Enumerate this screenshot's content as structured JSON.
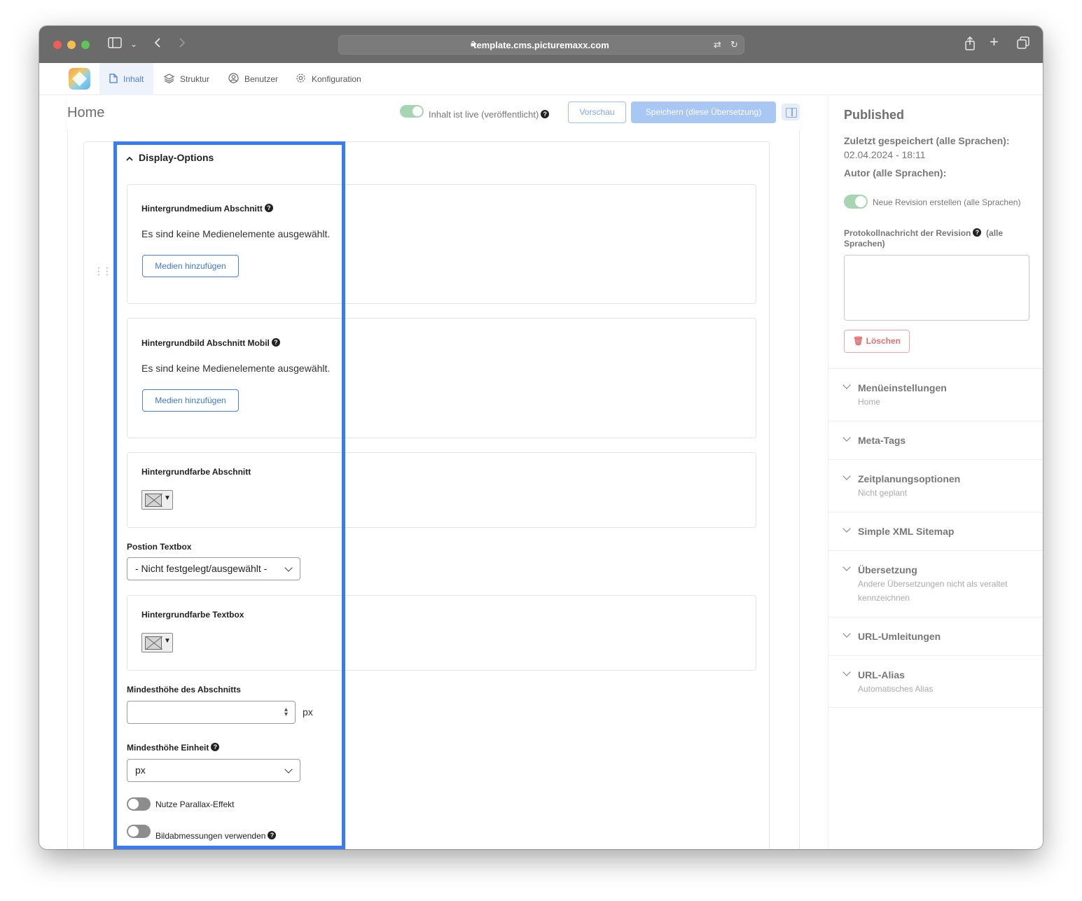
{
  "browser": {
    "url": "template.cms.picturemaxx.com"
  },
  "nav": {
    "items": [
      {
        "label": "Inhalt",
        "icon": "document-icon",
        "active": true
      },
      {
        "label": "Struktur",
        "icon": "layers-icon",
        "active": false
      },
      {
        "label": "Benutzer",
        "icon": "user-icon",
        "active": false
      },
      {
        "label": "Konfiguration",
        "icon": "gear-icon",
        "active": false
      }
    ]
  },
  "header": {
    "title": "Home",
    "live_label": "Inhalt ist live (veröffentlicht)",
    "preview_label": "Vorschau",
    "save_label": "Speichern (diese Übersetzung)"
  },
  "section": {
    "title": "Display-Options",
    "bg_media": {
      "label": "Hintergrundmedium Abschnitt",
      "empty_text": "Es sind keine Medienelemente ausgewählt.",
      "button": "Medien hinzufügen"
    },
    "bg_image_mobile": {
      "label": "Hintergrundbild Abschnitt Mobil",
      "empty_text": "Es sind keine Medienelemente ausgewählt.",
      "button": "Medien hinzufügen"
    },
    "bg_color_section": {
      "label": "Hintergrundfarbe Abschnitt"
    },
    "position_textbox": {
      "label": "Postion Textbox",
      "value": "- Nicht festgelegt/ausgewählt -"
    },
    "bg_color_textbox": {
      "label": "Hintergrundfarbe Textbox"
    },
    "min_height": {
      "label": "Mindesthöhe des Abschnitts",
      "value": "",
      "unit": "px"
    },
    "min_height_unit": {
      "label": "Mindesthöhe Einheit",
      "value": "px"
    },
    "parallax": {
      "label": "Nutze Parallax-Effekt",
      "on": false
    },
    "image_dims": {
      "label": "Bildabmessungen verwenden",
      "on": false
    }
  },
  "sidebar": {
    "status": "Published",
    "last_saved_label": "Zuletzt gespeichert (alle Sprachen):",
    "last_saved_value": "02.04.2024 - 18:11",
    "author_label": "Autor (alle Sprachen):",
    "new_revision_label": "Neue Revision erstellen (alle Sprachen)",
    "revision_log_label": "Protokollnachricht der Revision",
    "revision_log_suffix": "(alle Sprachen)",
    "delete_label": "Löschen",
    "accordions": [
      {
        "title": "Menüeinstellungen",
        "sub": "Home"
      },
      {
        "title": "Meta-Tags",
        "sub": ""
      },
      {
        "title": "Zeitplanungsoptionen",
        "sub": "Nicht geplant"
      },
      {
        "title": "Simple XML Sitemap",
        "sub": ""
      },
      {
        "title": "Übersetzung",
        "sub": "Andere Übersetzungen nicht als veraltet kennzeichnen"
      },
      {
        "title": "URL-Umleitungen",
        "sub": ""
      },
      {
        "title": "URL-Alias",
        "sub": "Automatisches Alias"
      }
    ]
  },
  "colors": {
    "accent": "#4a7fd8",
    "highlight": "#3a7bf0",
    "toggle_on": "#a8d5b1",
    "danger": "#e07070"
  }
}
